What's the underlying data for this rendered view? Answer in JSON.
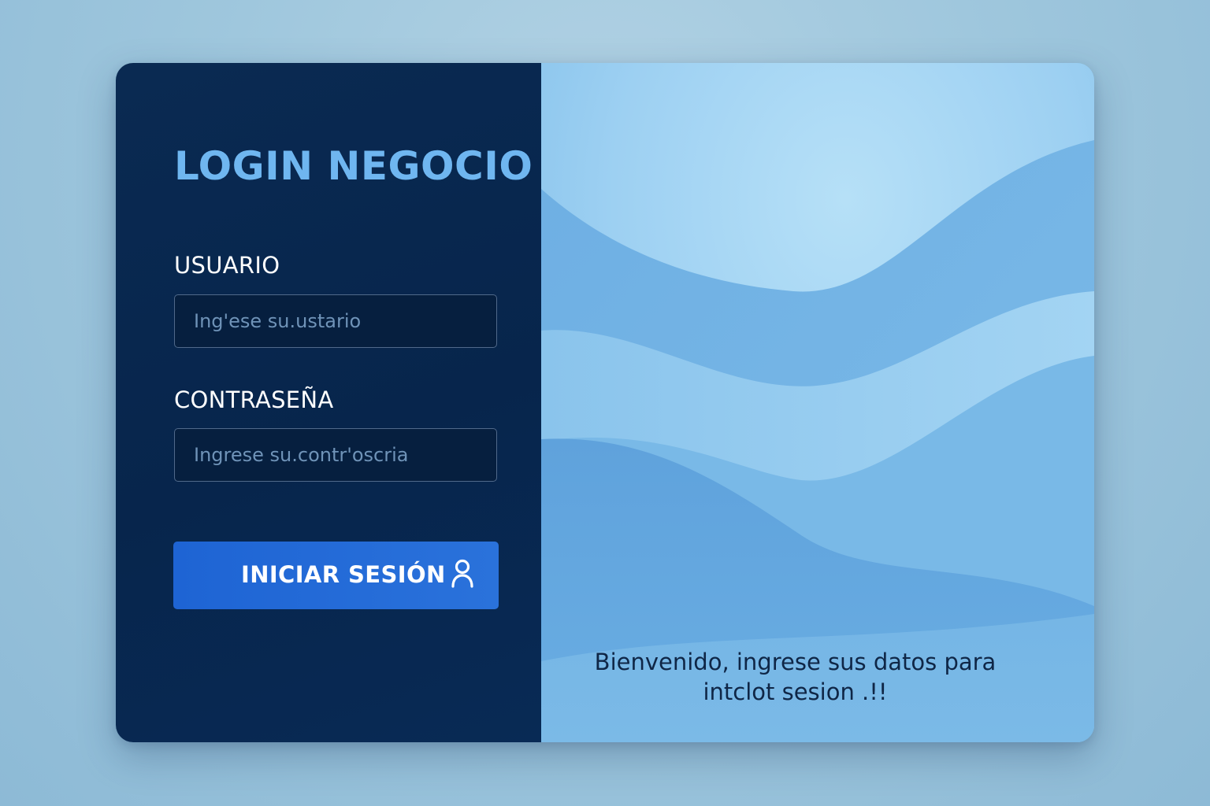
{
  "login": {
    "title": "LOGIN NEGOCIO",
    "username": {
      "label": "USUARIO",
      "placeholder": "Ing'ese su.ustario",
      "value": ""
    },
    "password": {
      "label": "CONTRASEÑA",
      "placeholder": "Ingrese su.contr'oscria",
      "value": ""
    },
    "submit": {
      "label": "INICIAR SESIÓN",
      "icon": "user-icon"
    }
  },
  "welcome": {
    "line1": "Bienvenido, ingrese sus datos para",
    "line2": "intclot sesion .!!"
  },
  "colors": {
    "page_background": "#9fc7dd",
    "panel_dark": "#07254c",
    "title_accent": "#6fb6f0",
    "button_primary": "#1e64d4",
    "wave_light": "#a6d6f4",
    "wave_mid": "#7cb9e6",
    "wave_deep": "#5fa3dc",
    "welcome_text": "#0f2646"
  }
}
